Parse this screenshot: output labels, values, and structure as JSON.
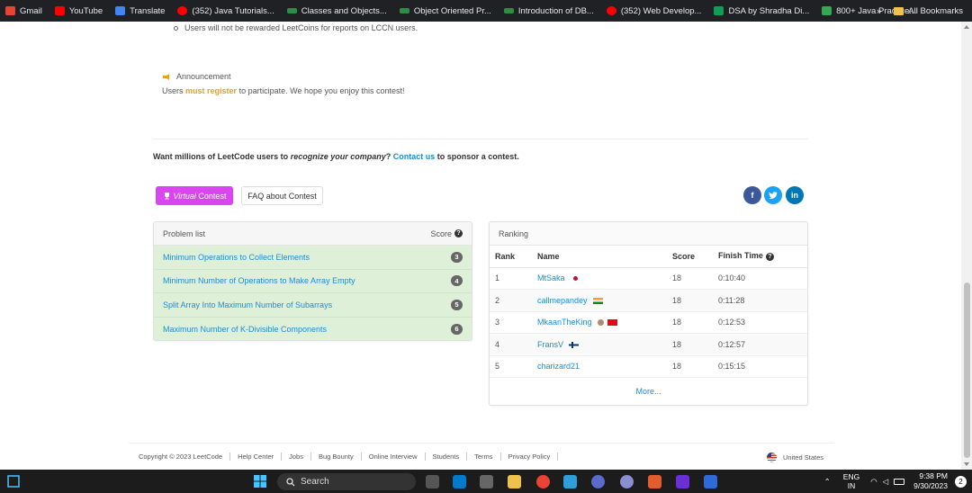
{
  "bookmarks": {
    "items": [
      {
        "label": "Gmail",
        "icon": "gmail-icon",
        "color": "#ea4335"
      },
      {
        "label": "YouTube",
        "icon": "youtube-icon",
        "color": "#ff0000"
      },
      {
        "label": "Translate",
        "icon": "translate-icon",
        "color": "#4285f4"
      },
      {
        "label": "(352) Java Tutorials...",
        "icon": "youtube-icon",
        "color": "#ff0000"
      },
      {
        "label": "Classes and Objects...",
        "icon": "gfg-icon",
        "color": "#2f8d46"
      },
      {
        "label": "Object Oriented Pr...",
        "icon": "gfg-icon",
        "color": "#2f8d46"
      },
      {
        "label": "Introduction of DB...",
        "icon": "gfg-icon",
        "color": "#2f8d46"
      },
      {
        "label": "(352) Web Develop...",
        "icon": "youtube-icon",
        "color": "#ff0000"
      },
      {
        "label": "DSA by Shradha Di...",
        "icon": "sheets-icon",
        "color": "#0f9d58"
      },
      {
        "label": "800+ Java Practice...",
        "icon": "practice-icon",
        "color": "#34a853"
      }
    ],
    "overflow": "»",
    "all_bookmarks": "All Bookmarks"
  },
  "rules": {
    "last_item": "Users will not be rewarded LeetCoins for reports on LCCN users."
  },
  "announcement": {
    "title": "Announcement",
    "prefix": "Users",
    "highlight": "must register",
    "suffix": "to participate. We hope you enjoy this contest!"
  },
  "sponsor": {
    "part1": "Want millions of LeetCode users to",
    "italic": "recognize your company",
    "part2": "?",
    "link": "Contact us",
    "part3": "to sponsor a contest."
  },
  "buttons": {
    "virtual_prefix": "Virtual",
    "virtual_suffix": "Contest",
    "faq": "FAQ about Contest"
  },
  "problems": {
    "header": "Problem list",
    "score_header": "Score",
    "items": [
      {
        "title": "Minimum Operations to Collect Elements",
        "score": "3"
      },
      {
        "title": "Minimum Number of Operations to Make Array Empty",
        "score": "4"
      },
      {
        "title": "Split Array Into Maximum Number of Subarrays",
        "score": "5"
      },
      {
        "title": "Maximum Number of K-Divisible Components",
        "score": "6"
      }
    ]
  },
  "ranking": {
    "header": "Ranking",
    "columns": [
      "Rank",
      "Name",
      "Score",
      "Finish Time"
    ],
    "rows": [
      {
        "rank": "1",
        "name": "MtSaka",
        "flag": "japan",
        "score": "18",
        "time": "0:10:40"
      },
      {
        "rank": "2",
        "name": "callmepandey",
        "flag": "india",
        "score": "18",
        "time": "0:11:28"
      },
      {
        "rank": "3",
        "name": "MkaanTheKing",
        "flag": "turkey",
        "score": "18",
        "time": "0:12:53"
      },
      {
        "rank": "4",
        "name": "FransV",
        "flag": "finland",
        "score": "18",
        "time": "0:12:57"
      },
      {
        "rank": "5",
        "name": "charizard21",
        "flag": "",
        "score": "18",
        "time": "0:15:15"
      }
    ],
    "more": "More..."
  },
  "footer": {
    "copyright": "Copyright © 2023 LeetCode",
    "links": [
      "Help Center",
      "Jobs",
      "Bug Bounty",
      "Online Interview",
      "Students",
      "Terms",
      "Privacy Policy"
    ],
    "region": "United States"
  },
  "taskbar": {
    "search": "Search",
    "lang1": "ENG",
    "lang2": "IN",
    "time": "9:38 PM",
    "date": "9/30/2023",
    "notifications": "2"
  },
  "colors": {
    "accent_blue": "#1a8cd8",
    "virtual_button": "#d946ef",
    "solved_row": "#dff0d8",
    "highlight_orange": "#ef9c1f",
    "facebook": "#3b5998",
    "twitter": "#1da1f2",
    "linkedin": "#0077b5"
  }
}
